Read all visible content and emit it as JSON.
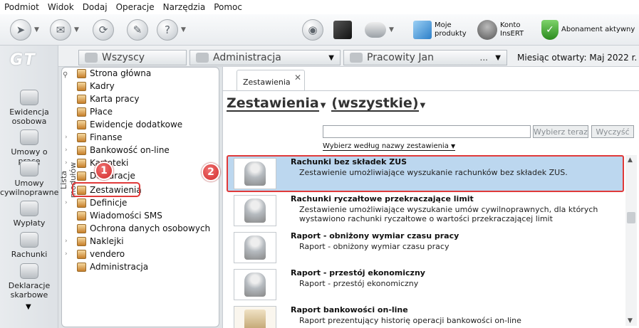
{
  "menu": [
    "Podmiot",
    "Widok",
    "Dodaj",
    "Operacje",
    "Narzędzia",
    "Pomoc"
  ],
  "toolbar": {
    "moje_produkty": [
      "Moje",
      "produkty"
    ],
    "konto": [
      "Konto",
      "InsERT"
    ],
    "abonament": "Abonament aktywny"
  },
  "logo": "GT",
  "leftnav": [
    [
      "Ewidencja",
      "osobowa"
    ],
    [
      "Umowy o pracę"
    ],
    [
      "Umowy",
      "cywilnoprawne"
    ],
    [
      "Wypłaty"
    ],
    [
      "Rachunki"
    ],
    [
      "Deklaracje",
      "skarbowe"
    ]
  ],
  "filters": {
    "all": "Wszyscy",
    "admin": "Administracja",
    "person": "Pracowity Jan",
    "ellipsis": "...",
    "month_label": "Miesiąc otwarty:",
    "month_value": "Maj 2022 r."
  },
  "modules": {
    "panel_label": "Lista modułów",
    "items": [
      "Strona główna",
      "Kadry",
      "Karta pracy",
      "Płace",
      "Ewidencje dodatkowe",
      "Finanse",
      "Bankowość on-line",
      "Kartoteki",
      "Deklaracje",
      "Zestawienia",
      "Definicje",
      "Wiadomości SMS",
      "Ochrona danych osobowych",
      "Naklejki",
      "vendero",
      "Administracja"
    ]
  },
  "badges": [
    "1",
    "2"
  ],
  "main": {
    "tab_label": "Zestawienia",
    "title": "Zestawienia",
    "filter": "(wszystkie)",
    "search_value": "",
    "btn_select": "Wybierz teraz",
    "btn_clear": "Wyczyść",
    "pick_label": "Wybierz według nazwy zestawienia",
    "rows": [
      {
        "t": "Rachunki bez składek ZUS",
        "d": "Zestawienie umożliwiające wyszukanie rachunków bez składek ZUS."
      },
      {
        "t": "Rachunki ryczałtowe przekraczające limit",
        "d": "Zestawienie umożliwiające wyszukanie umów cywilnoprawnych, dla których wystawiono rachunki ryczałtowe o wartości przekraczającej limit"
      },
      {
        "t": "Raport - obniżony wymiar czasu pracy",
        "d": "Raport - obniżony wymiar czasu pracy"
      },
      {
        "t": "Raport - przestój ekonomiczny",
        "d": "Raport - przestój ekonomiczny"
      },
      {
        "t": "Raport bankowości on-line",
        "d": "Raport prezentujący historię operacji bankowości on-line"
      }
    ]
  },
  "colors": {
    "selection": "#bcd7ef",
    "highlight": "#e03a3a",
    "badge": "#d22b2b"
  }
}
